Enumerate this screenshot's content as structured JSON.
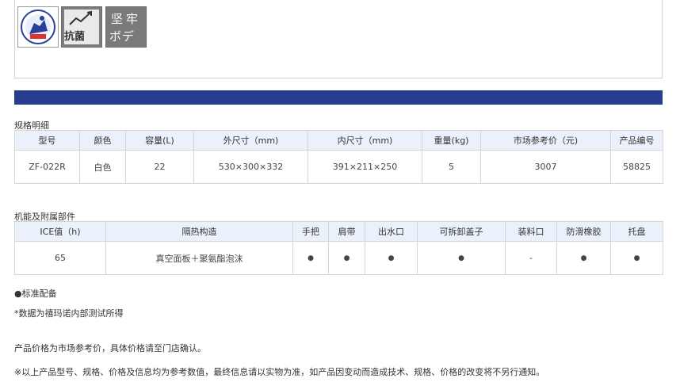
{
  "badges": {
    "badge2_label": "抗菌",
    "badge3_line1": "坚牢",
    "badge3_line2": "ボディ",
    "colors": {
      "bar": "#263e8f",
      "badge_gray": "#7a7a7a",
      "header_bg": "#eaf1fb"
    }
  },
  "specs": {
    "title": "规格明细",
    "headers": [
      "型号",
      "颜色",
      "容量(L)",
      "外尺寸（mm)",
      "内尺寸（mm)",
      "重量(kg)",
      "市场参考价（元)",
      "产品编号"
    ],
    "row": [
      "ZF-022R",
      "白色",
      "22",
      "530×300×332",
      "391×211×250",
      "5",
      "3007",
      "58825"
    ]
  },
  "features": {
    "title": "机能及附属部件",
    "headers": [
      "ICE值（h)",
      "隔热构造",
      "手把",
      "肩带",
      "出水口",
      "可拆卸盖子",
      "装料口",
      "防滑橡胶",
      "托盘"
    ],
    "row": [
      "65",
      "真空面板＋聚氨酯泡沫",
      "●",
      "●",
      "●",
      "●",
      "-",
      "●",
      "●"
    ]
  },
  "notes": {
    "standard": "●标准配备",
    "data_source": "*数据为禧玛诺内部测试所得",
    "price_note": "产品价格为市场参考价，具体价格请至门店确认。",
    "disclaimer": "※以上产品型号、规格、价格及信息均为参考数值，最终信息请以实物为准，如产品因变动而造成技术、规格、价格的改变将不另行通知。"
  }
}
